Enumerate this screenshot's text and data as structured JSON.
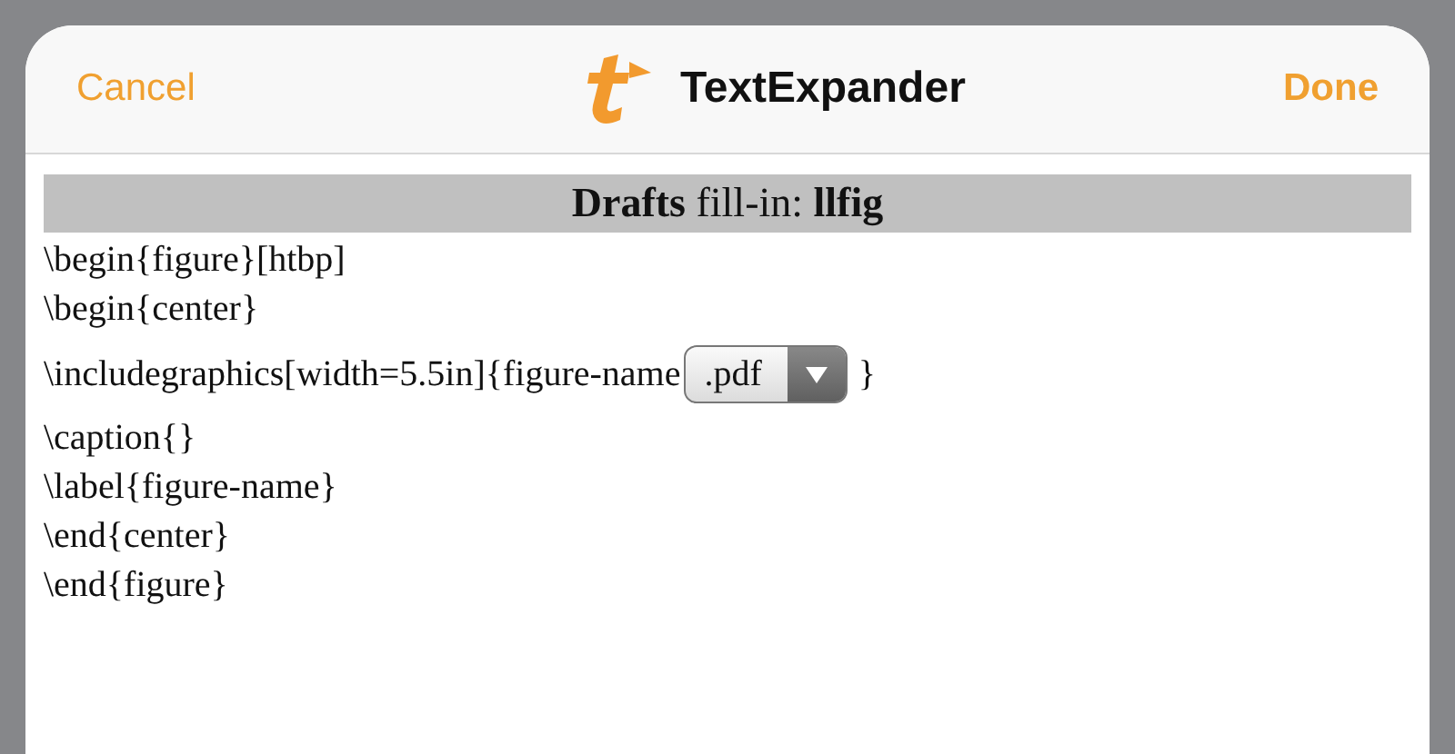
{
  "header": {
    "cancel": "Cancel",
    "title": "TextExpander",
    "done": "Done"
  },
  "fill_in": {
    "title": "**Drafts** fill-in: **llfig**",
    "lines": [
      {
        "kind": "text",
        "text": "\\begin{figure}[htbp]"
      },
      {
        "kind": "text",
        "text": "\\begin{center}"
      },
      {
        "kind": "popup",
        "before": "\\includegraphics[width=5.5in]{figure-name",
        "value": ".pdf",
        "after": "}"
      },
      {
        "kind": "text",
        "text": "\\caption{}"
      },
      {
        "kind": "text",
        "text": "\\label{figure-name}"
      },
      {
        "kind": "text",
        "text": "\\end{center}"
      },
      {
        "kind": "text",
        "text": "\\end{figure}"
      }
    ]
  }
}
